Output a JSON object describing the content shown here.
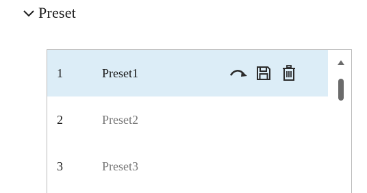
{
  "section": {
    "title": "Preset",
    "toggle_icon": "chevron-down-icon"
  },
  "presets": [
    {
      "number": "1",
      "name": "Preset1",
      "selected": true
    },
    {
      "number": "2",
      "name": "Preset2",
      "selected": false
    },
    {
      "number": "3",
      "name": "Preset3",
      "selected": false
    }
  ],
  "row_actions": {
    "icons": [
      "call-preset-icon",
      "save-icon",
      "delete-icon"
    ]
  },
  "colors": {
    "selected_row_bg": "#dcedf7",
    "icon_color": "#2b2b2b",
    "unselected_text": "#777777"
  }
}
